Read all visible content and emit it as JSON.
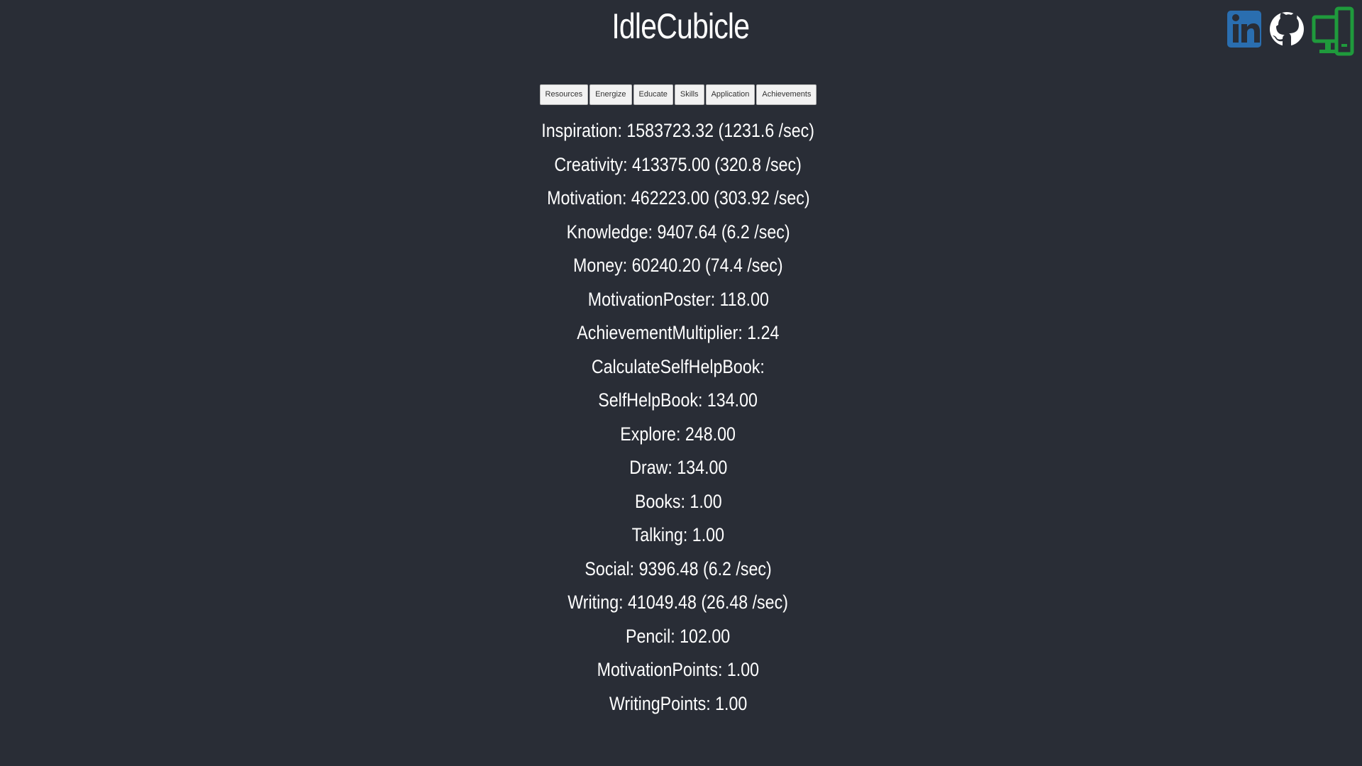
{
  "app": {
    "title": "IdleCubicle"
  },
  "social": [
    {
      "name": "linkedin-icon",
      "color": "#2a6eb0"
    },
    {
      "name": "github-icon",
      "color": "#ffffff"
    },
    {
      "name": "devices-icon",
      "color": "#1f9a3c"
    }
  ],
  "tabs": [
    "Resources",
    "Energize",
    "Educate",
    "Skills",
    "Application",
    "Achievements"
  ],
  "stats": [
    "Inspiration: 1583723.32 (1231.6 /sec)",
    "Creativity: 413375.00 (320.8 /sec)",
    "Motivation: 462223.00 (303.92 /sec)",
    "Knowledge: 9407.64 (6.2 /sec)",
    "Money: 60240.20 (74.4 /sec)",
    "MotivationPoster: 118.00",
    "AchievementMultiplier: 1.24",
    "CalculateSelfHelpBook:",
    "SelfHelpBook: 134.00",
    "Explore: 248.00",
    "Draw: 134.00",
    "Books: 1.00",
    "Talking: 1.00",
    "Social: 9396.48 (6.2 /sec)",
    "Writing: 41049.48 (26.48 /sec)",
    "Pencil: 102.00",
    "MotivationPoints: 1.00",
    "WritingPoints: 1.00"
  ]
}
